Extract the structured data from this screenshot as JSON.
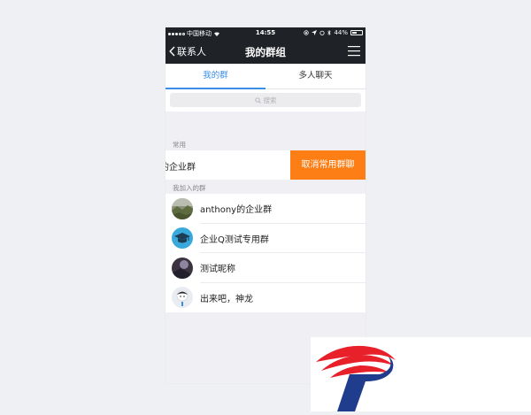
{
  "status_bar": {
    "carrier": "中国移动",
    "time": "14:55",
    "battery": "44%",
    "battery_level": 0.44
  },
  "nav": {
    "back_label": "联系人",
    "title": "我的群组"
  },
  "tabs": [
    {
      "label": "我的群",
      "active": true
    },
    {
      "label": "多人聊天",
      "active": false
    }
  ],
  "search": {
    "placeholder": "搜索"
  },
  "sections": {
    "frequent": "常用",
    "joined": "我加入的群"
  },
  "pinned": {
    "name": "的企业群",
    "action": "取消常用群聊"
  },
  "groups": [
    {
      "name": "anthony的企业群",
      "avatar": "landscape"
    },
    {
      "name": "企业Q测试专用群",
      "avatar": "graduation-cap"
    },
    {
      "name": "测试昵称",
      "avatar": "dark-photo"
    },
    {
      "name": "出来吧，神龙",
      "avatar": "cartoon-face"
    }
  ],
  "colors": {
    "nav_bg": "#1f2227",
    "accent": "#3a8ee6",
    "swipe_action": "#fd7e14"
  }
}
